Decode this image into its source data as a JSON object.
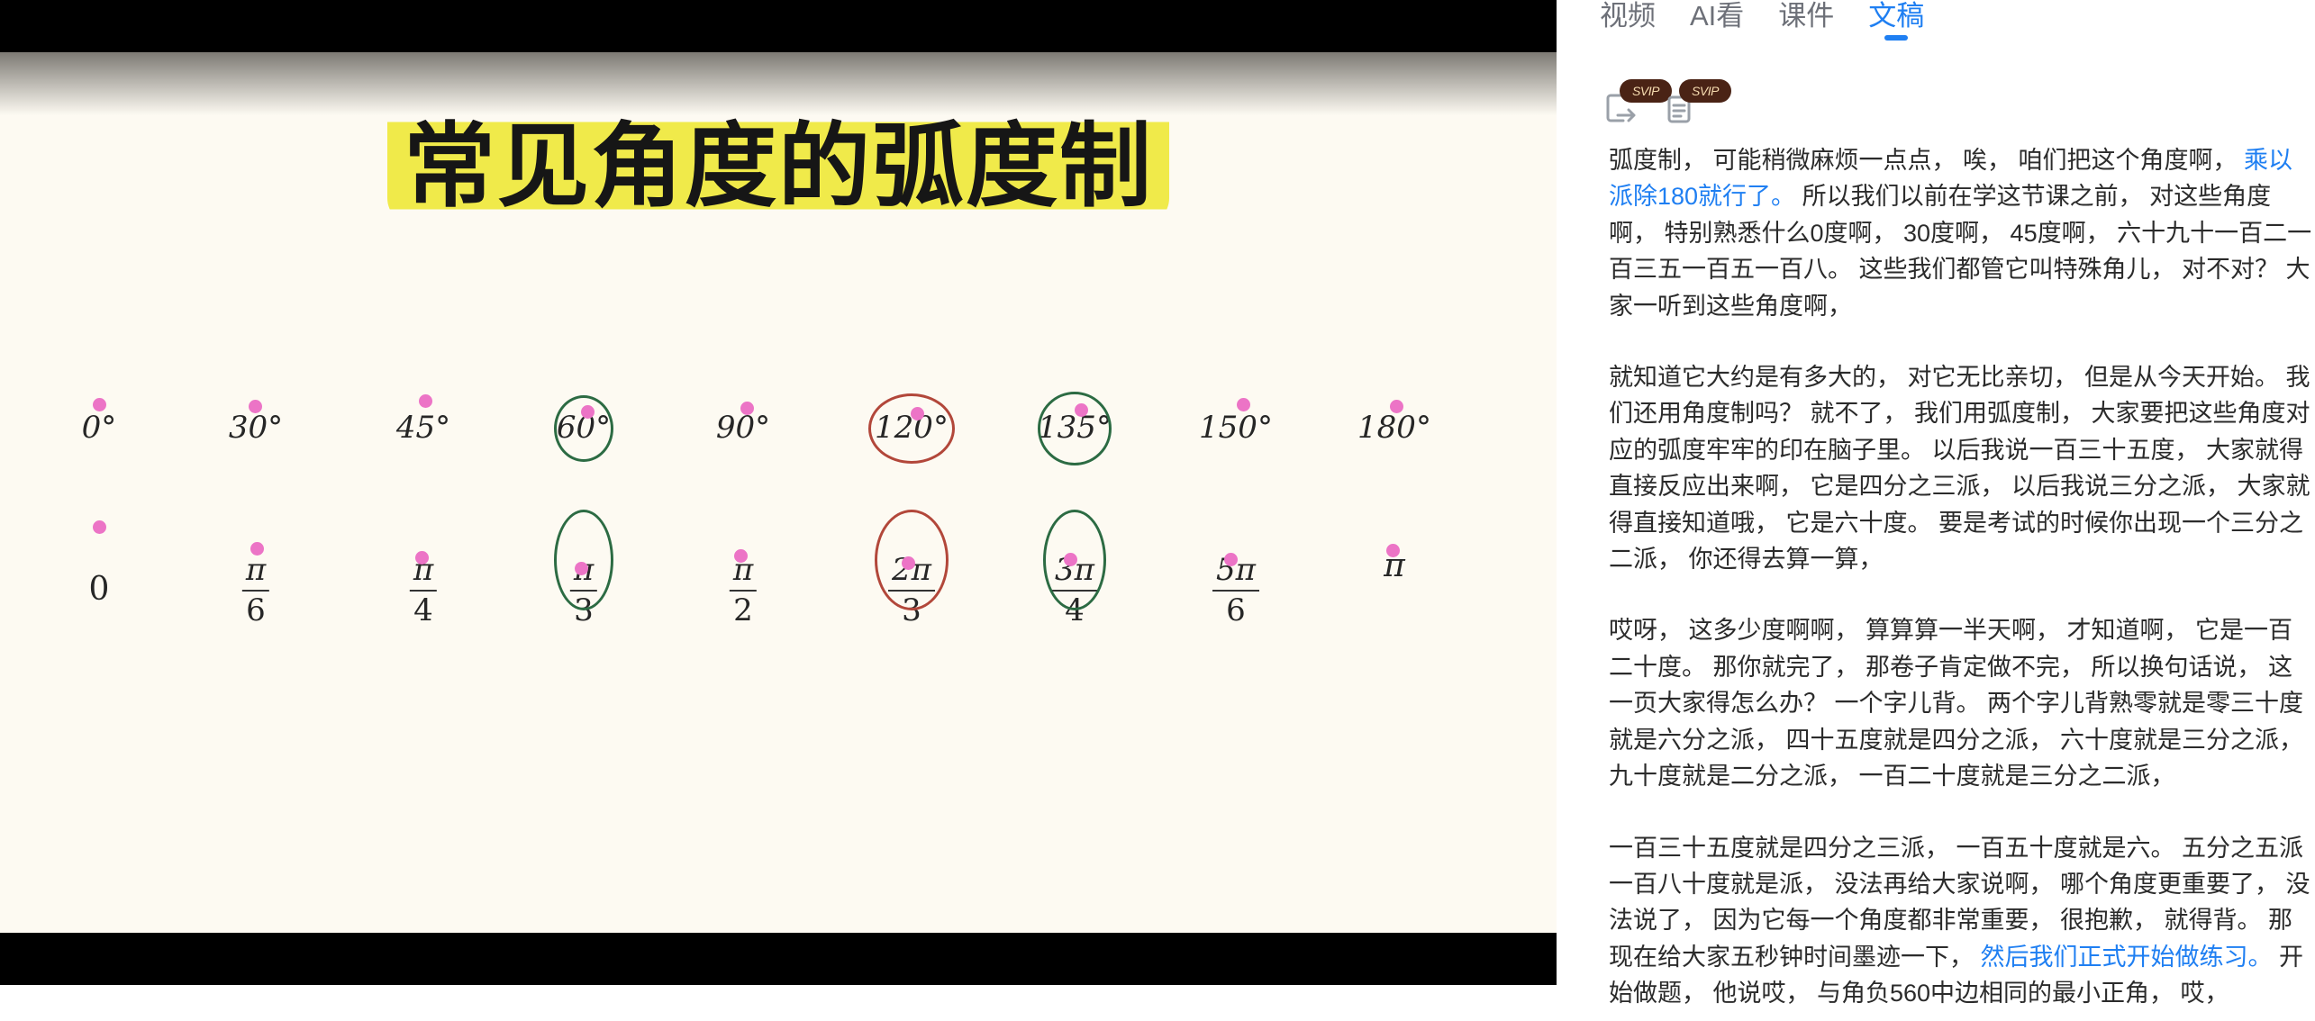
{
  "slide": {
    "title": "常见角度的弧度制",
    "degrees": [
      "0°",
      "30°",
      "45°",
      "60°",
      "90°",
      "120°",
      "135°",
      "150°",
      "180°"
    ],
    "radians": [
      {
        "plain": "0"
      },
      {
        "num": "π",
        "den": "6"
      },
      {
        "num": "π",
        "den": "4"
      },
      {
        "num": "π",
        "den": "3"
      },
      {
        "num": "π",
        "den": "2"
      },
      {
        "num": "2π",
        "den": "3"
      },
      {
        "num": "3π",
        "den": "4"
      },
      {
        "num": "5π",
        "den": "6"
      },
      {
        "plain": "π"
      }
    ],
    "circled": {
      "3": "green",
      "5": "red",
      "6": "green"
    },
    "colors": {
      "highlight": "#f0ea4a",
      "dot": "#ec74c6",
      "green_circle": "#2c6b43",
      "red_circle": "#b2473a"
    }
  },
  "panel": {
    "tabs": [
      "视频",
      "AI看",
      "课件",
      "文稿"
    ],
    "active_tab": "文稿",
    "tools": [
      {
        "icon": "export-icon",
        "badge": "SVIP"
      },
      {
        "icon": "document-copy-icon",
        "badge": "SVIP"
      }
    ],
    "accent": "#1f7ff2",
    "transcript": [
      [
        {
          "t": "弧度制， 可能稍微麻烦一点点， 唉， 咱们把这个角度啊， "
        },
        {
          "t": "乘以派除180就行了。",
          "hl": true
        },
        {
          "t": " 所以我们以前在学这节课之前， 对这些角度啊， 特别熟悉什么0度啊， 30度啊， 45度啊， 六十九十一百二一百三五一百五一百八。 这些我们都管它叫特殊角儿， 对不对？ 大家一听到这些角度啊，"
        }
      ],
      [
        {
          "t": "就知道它大约是有多大的， 对它无比亲切， 但是从今天开始。 我们还用角度制吗？ 就不了， 我们用弧度制， 大家要把这些角度对应的弧度牢牢的印在脑子里。 以后我说一百三十五度， 大家就得直接反应出来啊， 它是四分之三派， 以后我说三分之派， 大家就得直接知道哦， 它是六十度。 要是考试的时候你出现一个三分之二派， 你还得去算一算，"
        }
      ],
      [
        {
          "t": "哎呀， 这多少度啊啊， 算算算一半天啊， 才知道啊， 它是一百二十度。 那你就完了， 那卷子肯定做不完， 所以换句话说， 这一页大家得怎么办？ 一个字儿背。 两个字儿背熟零就是零三十度就是六分之派， 四十五度就是四分之派， 六十度就是三分之派， 九十度就是二分之派， 一百二十度就是三分之二派，"
        }
      ],
      [
        {
          "t": "一百三十五度就是四分之三派， 一百五十度就是六。 五分之五派一百八十度就是派， 没法再给大家说啊， 哪个角度更重要了， 没法说了， 因为它每一个角度都非常重要， 很抱歉， 就得背。 那现在给大家五秒钟时间墨迹一下， "
        },
        {
          "t": "然后我们正式开始做练习。",
          "hl": true
        },
        {
          "t": " 开始做题， 他说哎， 与角负560中边相同的最小正角， 哎，"
        }
      ]
    ]
  }
}
